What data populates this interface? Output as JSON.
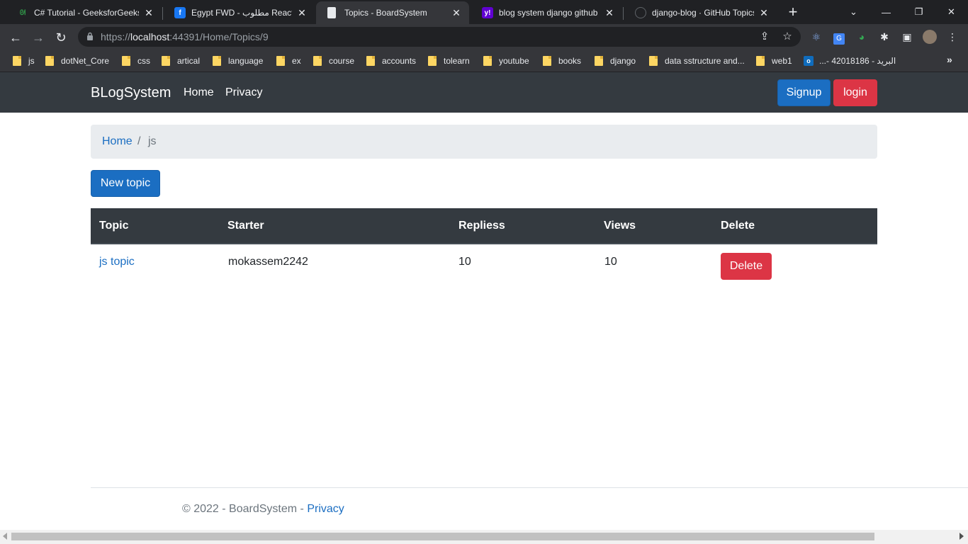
{
  "browser": {
    "tabs": [
      {
        "title": "C# Tutorial - GeeksforGeeks",
        "favicon": "geeksforgeeks-icon"
      },
      {
        "title": "Egypt FWD - مطلوب React D",
        "favicon": "facebook-icon"
      },
      {
        "title": "Topics - BoardSystem",
        "favicon": "page-icon",
        "active": true
      },
      {
        "title": "blog system django github -",
        "favicon": "yahoo-icon"
      },
      {
        "title": "django-blog · GitHub Topics",
        "favicon": "github-icon"
      }
    ],
    "address": {
      "scheme": "https://",
      "host": "localhost",
      "rest": ":44391/Home/Topics/9"
    },
    "bookmarks": [
      "js",
      "dotNet_Core",
      "css",
      "artical",
      "language",
      "ex",
      "course",
      "accounts",
      "tolearn",
      "youtube",
      "books",
      "django",
      "data sstructure and...",
      "web1",
      "البريد - 42018186 -..."
    ]
  },
  "site": {
    "brand": "BLogSystem",
    "nav": {
      "home": "Home",
      "privacy": "Privacy"
    },
    "auth": {
      "signup": "Signup",
      "login": "login"
    }
  },
  "breadcrumb": {
    "home": "Home",
    "separator": "/",
    "current": "js"
  },
  "actions": {
    "new_topic": "New topic"
  },
  "table": {
    "headers": [
      "Topic",
      "Starter",
      "Repliess",
      "Views",
      "Delete"
    ],
    "rows": [
      {
        "topic": "js topic",
        "starter": "mokassem2242",
        "replies": "10",
        "views": "10",
        "delete": "Delete"
      }
    ]
  },
  "footer": {
    "copyright": "© 2022 - BoardSystem - ",
    "link": "Privacy"
  },
  "colors": {
    "navbar": "#343a40",
    "primary": "#1b6ec2",
    "danger": "#dc3545",
    "breadcrumb_bg": "#e9ecef"
  }
}
